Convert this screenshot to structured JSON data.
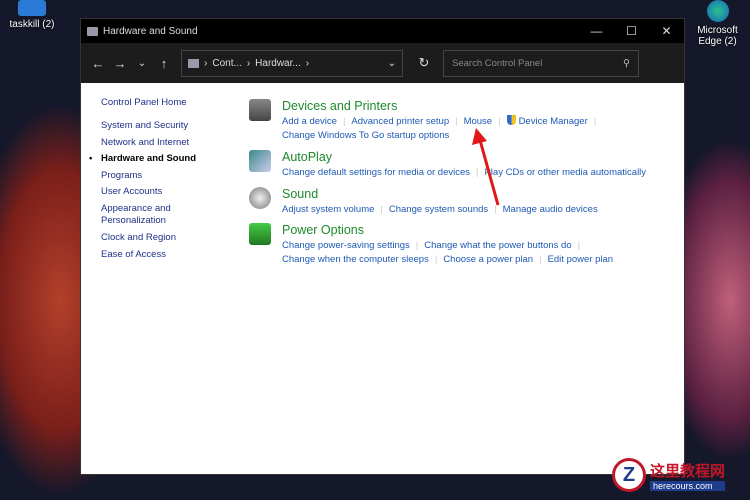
{
  "desktop": {
    "icons": [
      {
        "label": "taskkill (2)"
      },
      {
        "label": "Microsoft Edge (2)"
      }
    ]
  },
  "window": {
    "title": "Hardware and Sound",
    "controls": [
      "—",
      "☐",
      "✕"
    ]
  },
  "toolbar": {
    "back": "←",
    "forward": "→",
    "recent": "⌄",
    "up": "↑",
    "breadcrumb": [
      "Cont...",
      "Hardwar..."
    ],
    "sep": "›",
    "dropdown": "⌄",
    "refresh": "↻",
    "search_placeholder": "Search Control Panel",
    "search_icon": "⚲"
  },
  "sidebar": {
    "items": [
      {
        "label": "Control Panel Home"
      },
      {
        "label": "System and Security"
      },
      {
        "label": "Network and Internet"
      },
      {
        "label": "Hardware and Sound",
        "current": true
      },
      {
        "label": "Programs"
      },
      {
        "label": "User Accounts"
      },
      {
        "label": "Appearance and Personalization"
      },
      {
        "label": "Clock and Region"
      },
      {
        "label": "Ease of Access"
      }
    ]
  },
  "categories": [
    {
      "title": "Devices and Printers",
      "links": [
        [
          "Add a device",
          "Advanced printer setup",
          "Mouse",
          "Device Manager"
        ],
        [
          "Change Windows To Go startup options"
        ]
      ]
    },
    {
      "title": "AutoPlay",
      "links": [
        [
          "Change default settings for media or devices",
          "Play CDs or other media automatically"
        ]
      ]
    },
    {
      "title": "Sound",
      "links": [
        [
          "Adjust system volume",
          "Change system sounds",
          "Manage audio devices"
        ]
      ]
    },
    {
      "title": "Power Options",
      "links": [
        [
          "Change power-saving settings",
          "Change what the power buttons do"
        ],
        [
          "Change when the computer sleeps",
          "Choose a power plan",
          "Edit power plan"
        ]
      ]
    }
  ],
  "watermark": {
    "logo": "Z",
    "name": "这里教程网",
    "url": "herecours.com"
  },
  "colors": {
    "accent_green": "#1e8a2a",
    "link_blue": "#1e5ab4",
    "arrow_red": "#e01818"
  }
}
